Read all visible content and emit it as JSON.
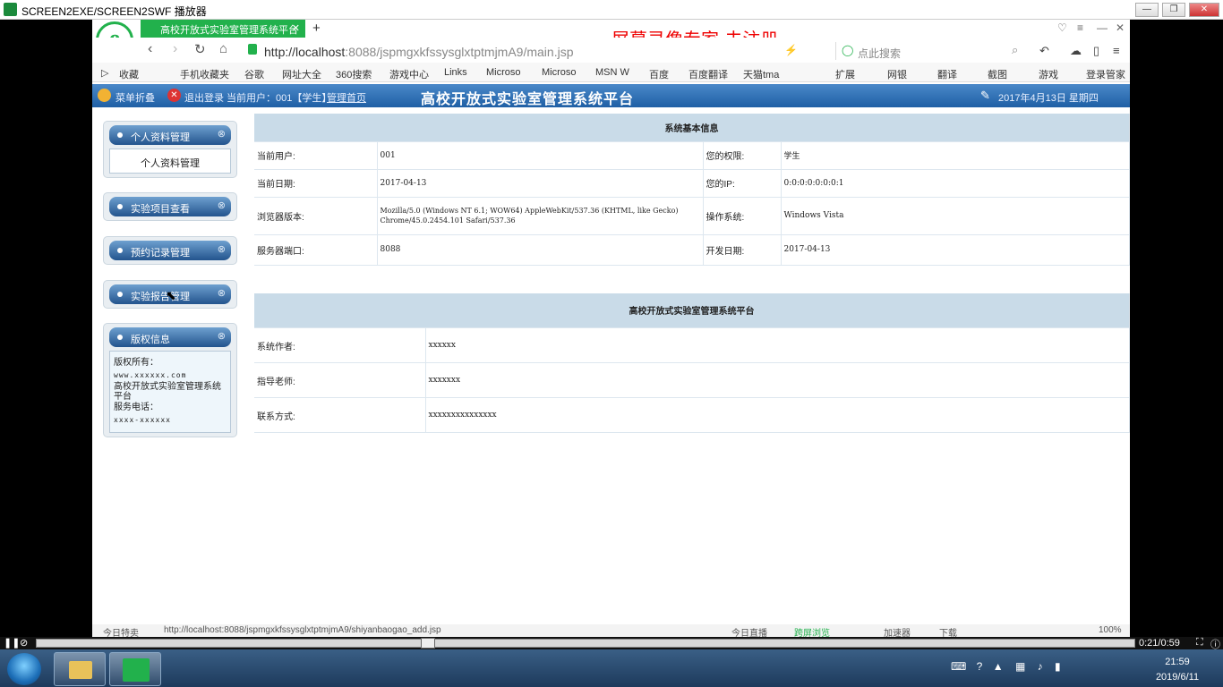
{
  "player": {
    "title": "SCREEN2EXE/SCREEN2SWF 播放器",
    "time": "0:21/0:59"
  },
  "browser": {
    "tab_title": "高校开放式实验室管理系统平台",
    "url_host": "http://localhost",
    "url_rest": ":8088/jspmgxkfssysglxtptmjmA9/main.jsp",
    "search_placeholder": "点此搜索",
    "watermark": "屏幕录像专家  未注册",
    "bookmarks": [
      "收藏",
      "手机收藏夹",
      "谷歌",
      "网址大全",
      "360搜索",
      "游戏中心",
      "Links",
      "Microso",
      "Microso",
      "MSN W",
      "百度",
      "百度翻译",
      "天猫tma",
      "扩展",
      "网银",
      "翻译",
      "截图",
      "游戏",
      "登录管家"
    ],
    "status_left": "今日特卖",
    "status_url": "http://localhost:8088/jspmgxkfssysglxtptmjmA9/shiyanbaogao_add.jsp",
    "status_right": [
      "今日直播",
      "跨屏浏览",
      "加速器",
      "下载",
      "100%"
    ]
  },
  "appbar": {
    "fold": "菜单折叠",
    "logout": "退出登录",
    "current_user": "当前用户：001【学生】",
    "home": "管理首页",
    "title": "高校开放式实验室管理系统平台",
    "date": "2017年4月13日 星期四"
  },
  "menu": {
    "profile_header": "个人资料管理",
    "profile_item": "个人资料管理",
    "project_header": "实验项目查看",
    "booking_header": "预约记录管理",
    "report_header": "实验报告管理",
    "copyright_header": "版权信息",
    "copyright_owner_label": "版权所有：",
    "copyright_site": "www.xxxxxx.com",
    "copyright_name": "高校开放式实验室管理系统平台",
    "phone_label": "服务电话：",
    "phone": "xxxx-xxxxxx"
  },
  "info": {
    "title": "系统基本信息",
    "current_user_label": "当前用户:",
    "current_user": "001",
    "role_label": "您的权限:",
    "role": "学生",
    "date_label": "当前日期:",
    "date": "2017-04-13",
    "ip_label": "您的IP:",
    "ip": "0:0:0:0:0:0:0:1",
    "browser_label": "浏览器版本:",
    "browser": "Mozilla/5.0 (Windows NT 6.1; WOW64) AppleWebKit/537.36 (KHTML, like Gecko) Chrome/45.0.2454.101 Safari/537.36",
    "os_label": "操作系统:",
    "os": "Windows Vista",
    "port_label": "服务器端口:",
    "port": "8088",
    "dev_date_label": "开发日期:",
    "dev_date": "2017-04-13"
  },
  "about": {
    "title": "高校开放式实验室管理系统平台",
    "author_label": "系统作者:",
    "author": "xxxxxx",
    "teacher_label": "指导老师:",
    "teacher": "xxxxxxx",
    "contact_label": "联系方式:",
    "contact": "xxxxxxxxxxxxxxx"
  },
  "taskbar": {
    "time": "21:59",
    "date": "2019/6/11"
  },
  "colors": {
    "brand_green": "#22b14c",
    "header_blue": "#1f5fa5",
    "table_head": "#c9dbe8",
    "watermark_red": "#e00000"
  }
}
